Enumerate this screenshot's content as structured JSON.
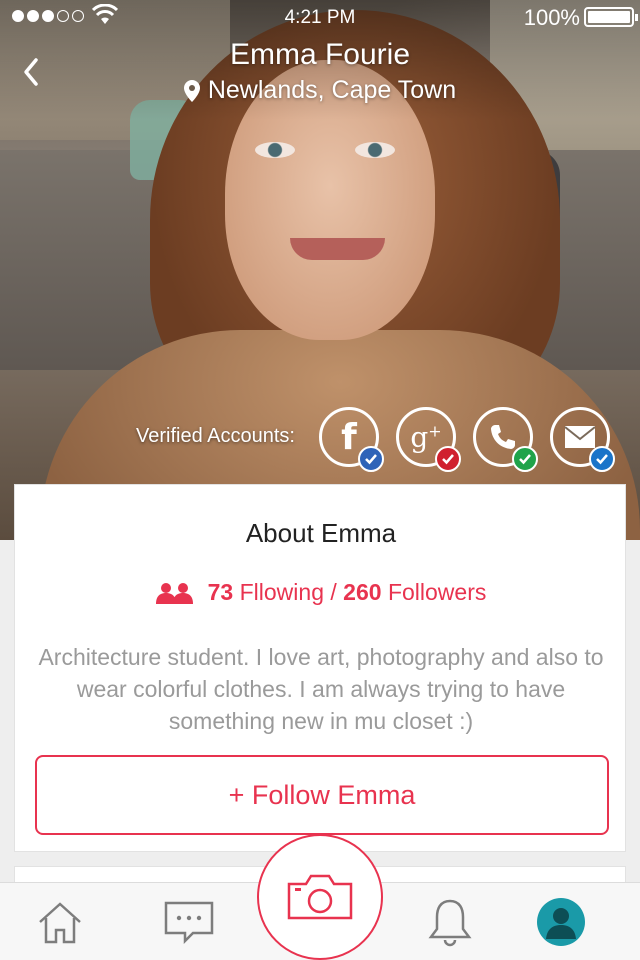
{
  "status_bar": {
    "time": "4:21 PM",
    "battery_percent": "100%",
    "signal_bars": 3,
    "signal_total": 5
  },
  "header": {
    "name": "Emma Fourie",
    "location": "Newlands, Cape Town",
    "icons": [
      "back-chevron-icon",
      "location-pin-icon"
    ]
  },
  "verified": {
    "label": "Verified Accounts:",
    "accounts": [
      {
        "service": "facebook",
        "glyph": "f",
        "check_color": "#2e63b8"
      },
      {
        "service": "google-plus",
        "glyph": "g+",
        "check_color": "#d0202e"
      },
      {
        "service": "phone",
        "glyph": "",
        "check_color": "#1fa34a"
      },
      {
        "service": "email",
        "glyph": "",
        "check_color": "#1a74c9"
      }
    ]
  },
  "about": {
    "title": "About Emma",
    "following_count": "73",
    "following_label": "Fllowing",
    "separator": "/",
    "followers_count": "260",
    "followers_label": "Followers",
    "bio": "Architecture student. I love art, photography and also to wear colorful clothes. I am always trying to have something new in mu closet :)",
    "follow_button": "+ Follow Emma"
  },
  "tab_bar": {
    "tabs": [
      "home-icon",
      "chat-icon",
      "camera-icon",
      "bell-icon",
      "profile-icon"
    ],
    "active": "profile-icon"
  },
  "colors": {
    "accent": "#e8334f",
    "profile_active": "#1a9aa8",
    "text_muted": "#9a9a9a"
  }
}
